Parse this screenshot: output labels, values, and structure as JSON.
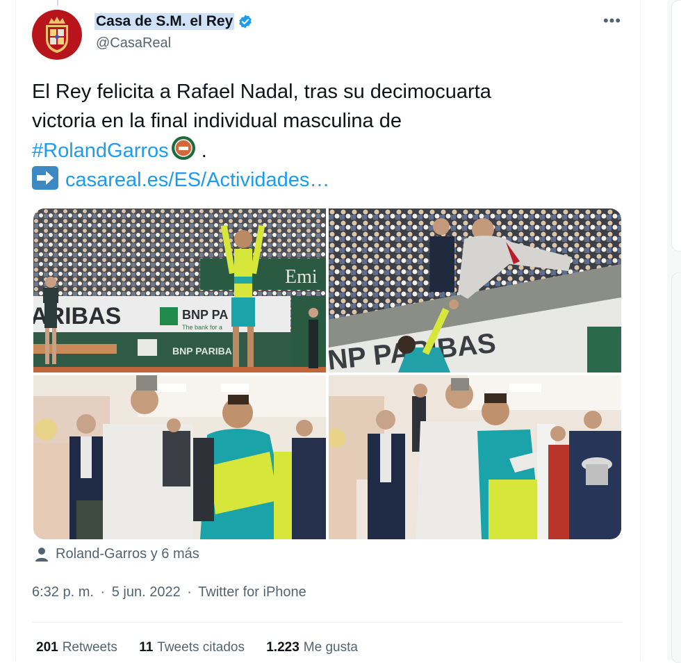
{
  "author": {
    "display_name": "Casa de S.M. el Rey",
    "handle": "@CasaReal",
    "verified": true,
    "avatar_icon": "royal-coat-of-arms"
  },
  "tweet": {
    "line1": "El Rey felicita a Rafael Nadal, tras su decimocuarta",
    "line2": "victoria en la final individual masculina de",
    "hashtag": "#RolandGarros",
    "hashtag_suffix": " .",
    "link": "casareal.es/ES/Actividades…"
  },
  "media": {
    "photo_count": 4,
    "sign_texts": {
      "emirates": "Emi",
      "bnp_big": "ARIBAS",
      "bnp_paribas": "BNP PA",
      "bnp_tagline": "The bank for a",
      "bnp_lower": "BNP PARIBA",
      "photo2_board": "NP  PARIBAS"
    }
  },
  "tagged": "Roland-Garros y 6 más",
  "meta": {
    "time": "6:32 p. m.",
    "separator": "·",
    "date": "5 jun. 2022",
    "source": "Twitter for iPhone"
  },
  "stats": {
    "retweets_count": "201",
    "retweets_label": "Retweets",
    "quotes_count": "11",
    "quotes_label": "Tweets citados",
    "likes_count": "1.223",
    "likes_label": "Me gusta"
  },
  "colors": {
    "link": "#1d9bf0",
    "verified": "#1d9bf0",
    "secondary_text": "#536471",
    "clay": "#c0643a",
    "court_green": "#1f5a3f",
    "nadal_yellow": "#d7e63a",
    "nadal_teal": "#1aa3a8"
  }
}
